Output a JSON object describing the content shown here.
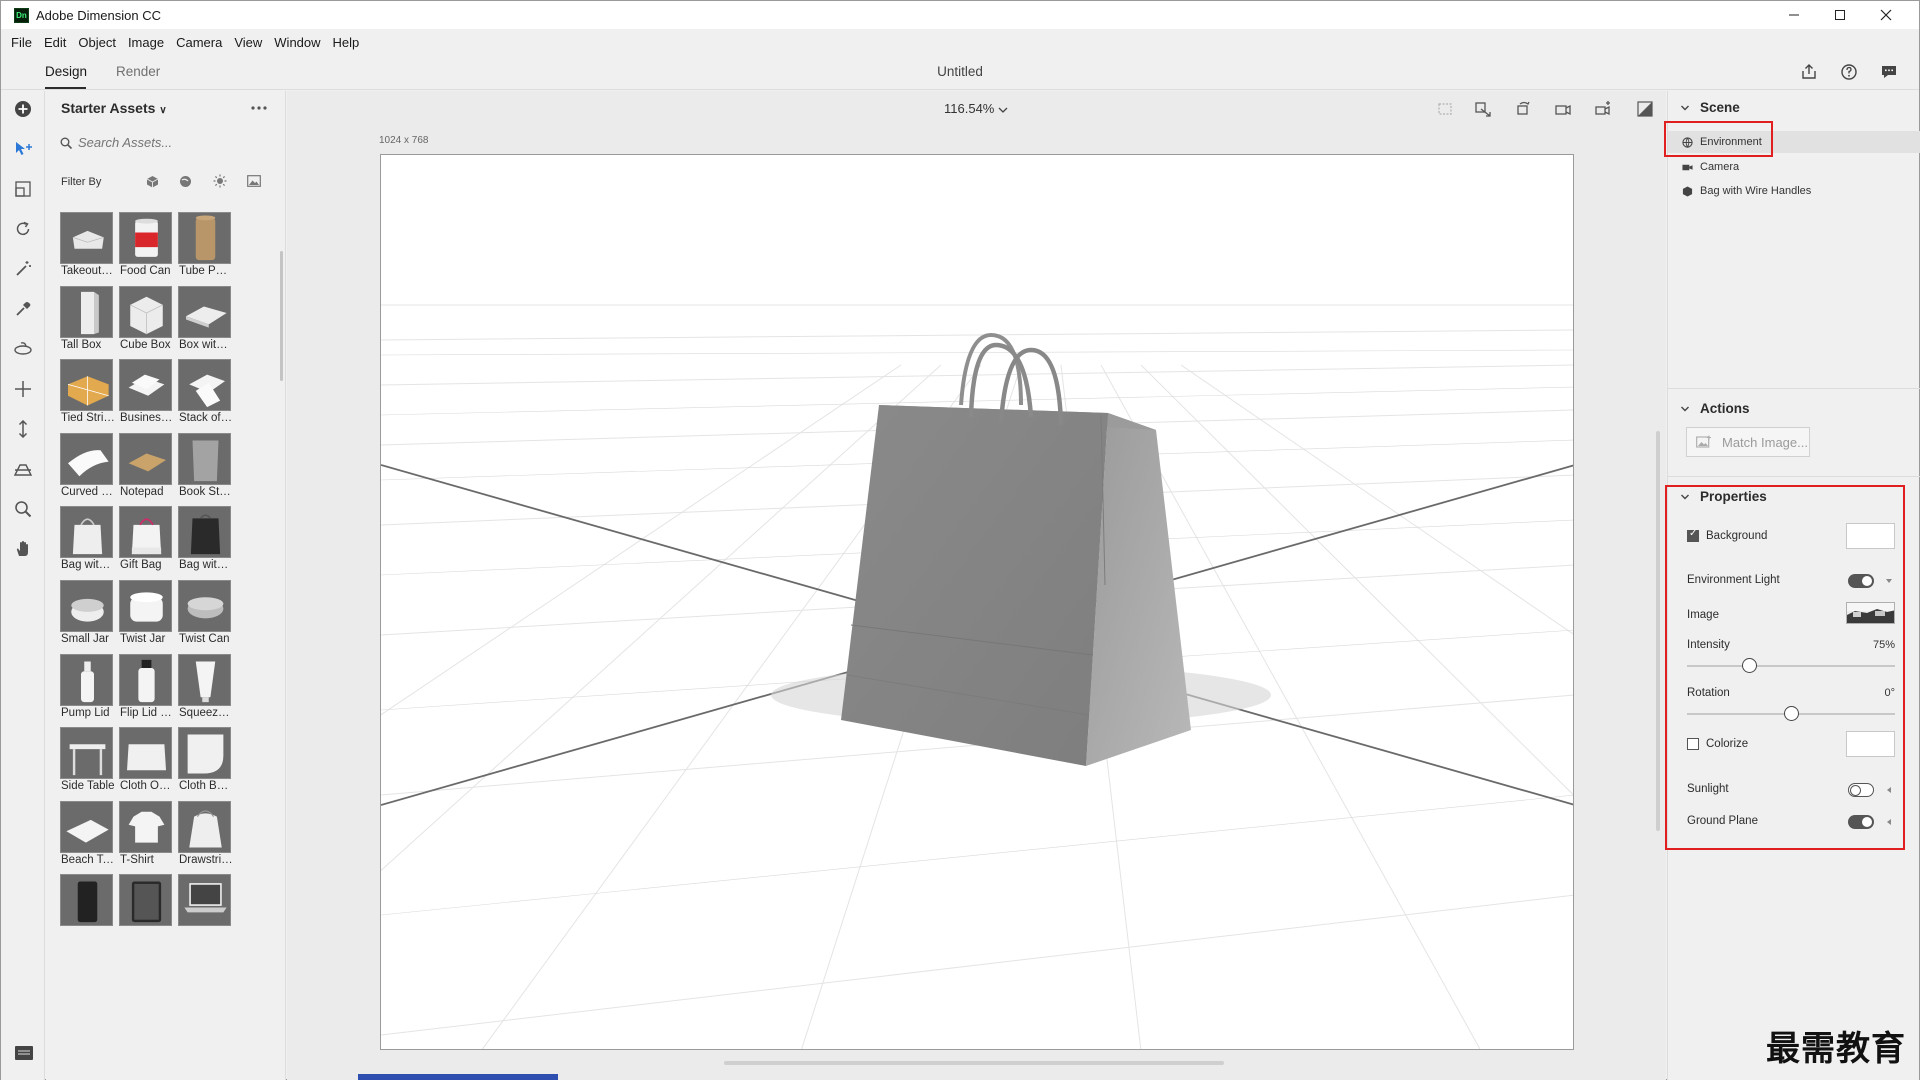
{
  "window": {
    "app_icon_text": "Dn",
    "title": "Adobe Dimension CC"
  },
  "menu": [
    "File",
    "Edit",
    "Object",
    "Image",
    "Camera",
    "View",
    "Window",
    "Help"
  ],
  "header": {
    "tabs": [
      "Design",
      "Render"
    ],
    "active_tab": "Design",
    "document_title": "Untitled"
  },
  "assets": {
    "title": "Starter Assets",
    "search_placeholder": "Search Assets...",
    "filter_label": "Filter By",
    "items": [
      {
        "label": "Takeout B...",
        "icon": "takeout-box"
      },
      {
        "label": "Food Can",
        "icon": "food-can"
      },
      {
        "label": "Tube Pack...",
        "icon": "tube-package"
      },
      {
        "label": "Tall Box",
        "icon": "tall-box"
      },
      {
        "label": "Cube Box",
        "icon": "cube-box"
      },
      {
        "label": "Box with ...",
        "icon": "box-with-lid"
      },
      {
        "label": "Tied Strin...",
        "icon": "tied-string-box"
      },
      {
        "label": "Business ...",
        "icon": "business-cards"
      },
      {
        "label": "Stack of C...",
        "icon": "stack-of-cards"
      },
      {
        "label": "Curved Pl...",
        "icon": "curved-plane"
      },
      {
        "label": "Notepad",
        "icon": "notepad"
      },
      {
        "label": "Book Stan...",
        "icon": "book-standing"
      },
      {
        "label": "Bag with ...",
        "icon": "bag-white"
      },
      {
        "label": "Gift Bag",
        "icon": "gift-bag"
      },
      {
        "label": "Bag with ...",
        "icon": "bag-black"
      },
      {
        "label": "Small Jar",
        "icon": "small-jar"
      },
      {
        "label": "Twist Jar",
        "icon": "twist-jar"
      },
      {
        "label": "Twist Can",
        "icon": "twist-can"
      },
      {
        "label": "Pump Lid",
        "icon": "pump-lid"
      },
      {
        "label": "Flip Lid B...",
        "icon": "flip-lid-bottle"
      },
      {
        "label": "Squeeze T...",
        "icon": "squeeze-tube"
      },
      {
        "label": "Side Table",
        "icon": "side-table"
      },
      {
        "label": "Cloth On ...",
        "icon": "cloth-on-table"
      },
      {
        "label": "Cloth Bac...",
        "icon": "cloth-backdrop"
      },
      {
        "label": "Beach To...",
        "icon": "beach-towel"
      },
      {
        "label": "T-Shirt",
        "icon": "t-shirt"
      },
      {
        "label": "Drawstrin...",
        "icon": "drawstring-bag"
      },
      {
        "label": "",
        "icon": "phone"
      },
      {
        "label": "",
        "icon": "tablet"
      },
      {
        "label": "",
        "icon": "laptop"
      }
    ]
  },
  "viewport": {
    "zoom": "116.54%",
    "canvas_size": "1024 x 768"
  },
  "scene": {
    "title": "Scene",
    "items": [
      {
        "label": "Environment",
        "icon": "globe-icon"
      },
      {
        "label": "Camera",
        "icon": "camera-icon"
      },
      {
        "label": "Bag with Wire Handles",
        "icon": "model-icon"
      }
    ],
    "selected": "Environment"
  },
  "actions": {
    "title": "Actions",
    "match_image": "Match Image..."
  },
  "properties": {
    "title": "Properties",
    "background": {
      "label": "Background",
      "checked": true,
      "color": "#ffffff"
    },
    "environment_light": {
      "label": "Environment Light",
      "on": true
    },
    "image_label": "Image",
    "intensity": {
      "label": "Intensity",
      "value_text": "75%",
      "value": 0.3
    },
    "rotation": {
      "label": "Rotation",
      "value_text": "0°",
      "value": 0.5
    },
    "colorize": {
      "label": "Colorize",
      "checked": false,
      "color": "#ffffff"
    },
    "sunlight": {
      "label": "Sunlight",
      "on": false
    },
    "ground_plane": {
      "label": "Ground Plane",
      "on": true
    }
  },
  "watermark": "最需教育",
  "colors": {
    "highlight": "#e02020",
    "panel": "#f0f0f0",
    "canvas": "#ffffff"
  }
}
